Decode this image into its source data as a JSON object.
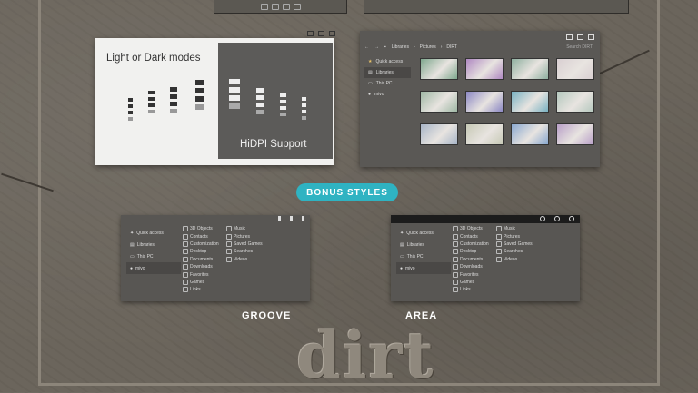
{
  "modes_card": {
    "title": "Light or Dark modes",
    "caption": "HiDPI Support"
  },
  "explorer": {
    "breadcrumbs": [
      "Libraries",
      "Pictures",
      "DIRT"
    ],
    "search_placeholder": "Search DIRT",
    "nav": [
      "Quick access",
      "Libraries",
      "This PC",
      "mivo"
    ],
    "thumb_colors": [
      [
        "#7fa88e",
        "#b089c2",
        "#8fb0a0",
        "#d9cfd2"
      ],
      [
        "#9fb8a5",
        "#8c88c4",
        "#79b2c2",
        "#b5c8be"
      ],
      [
        "#a8b5c7",
        "#c7c9b6",
        "#8aa9d0",
        "#b9a0c8"
      ]
    ]
  },
  "bonus_badge": "BONUS STYLES",
  "mini_nav": [
    "Quick access",
    "Libraries",
    "This PC",
    "mivo"
  ],
  "mini_col1": [
    "3D Objects",
    "Contacts",
    "Customization",
    "Desktop",
    "Documents",
    "Downloads",
    "Favorites",
    "Games",
    "Links"
  ],
  "mini_col2": [
    "Music",
    "Pictures",
    "Saved Games",
    "Searches",
    "Videos"
  ],
  "styles": {
    "groove": "GROOVE",
    "area": "AREA"
  },
  "logo": "dirt",
  "colors": {
    "accent": "#2fb3c2",
    "background": "#6b655c"
  }
}
